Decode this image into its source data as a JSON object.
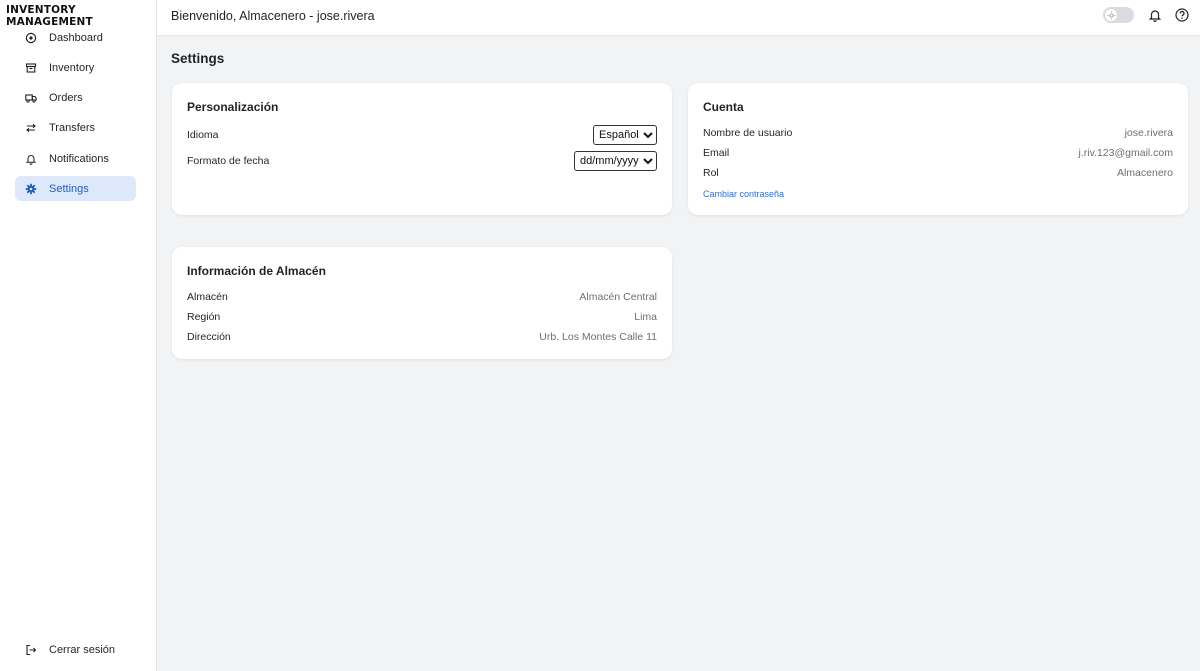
{
  "app": {
    "brand": "INVENTORY MANAGEMENT"
  },
  "sidebar": {
    "items": [
      {
        "label": "Dashboard",
        "icon": "dashboard-icon",
        "active": false
      },
      {
        "label": "Inventory",
        "icon": "archive-icon",
        "active": false
      },
      {
        "label": "Orders",
        "icon": "truck-icon",
        "active": false
      },
      {
        "label": "Transfers",
        "icon": "arrows-left-right-icon",
        "active": false
      },
      {
        "label": "Notifications",
        "icon": "bell-icon",
        "active": false
      },
      {
        "label": "Settings",
        "icon": "gear-icon",
        "active": true
      }
    ],
    "logout_label": "Cerrar sesión"
  },
  "header": {
    "welcome": "Bienvenido, Almacenero - jose.rivera"
  },
  "page": {
    "title": "Settings"
  },
  "personalization": {
    "title": "Personalización",
    "language_label": "Idioma",
    "language_value": "Español",
    "date_format_label": "Formato de fecha",
    "date_format_value": "dd/mm/yyyy"
  },
  "account": {
    "title": "Cuenta",
    "username_label": "Nombre de usuario",
    "username_value": "jose.rivera",
    "email_label": "Email",
    "email_value": "j.riv.123@gmail.com",
    "role_label": "Rol",
    "role_value": "Almacenero",
    "change_password": "Cambiar contraseña"
  },
  "warehouse": {
    "title": "Información de Almacén",
    "name_label": "Almacén",
    "name_value": "Almacén Central",
    "region_label": "Región",
    "region_value": "Lima",
    "address_label": "Dirección",
    "address_value": "Urb. Los Montes Calle 11"
  },
  "colors": {
    "accent": "#1f5fbf",
    "active_bg": "#dde8fb",
    "link": "#2f6fd1",
    "page_bg": "#f2f3f5"
  }
}
